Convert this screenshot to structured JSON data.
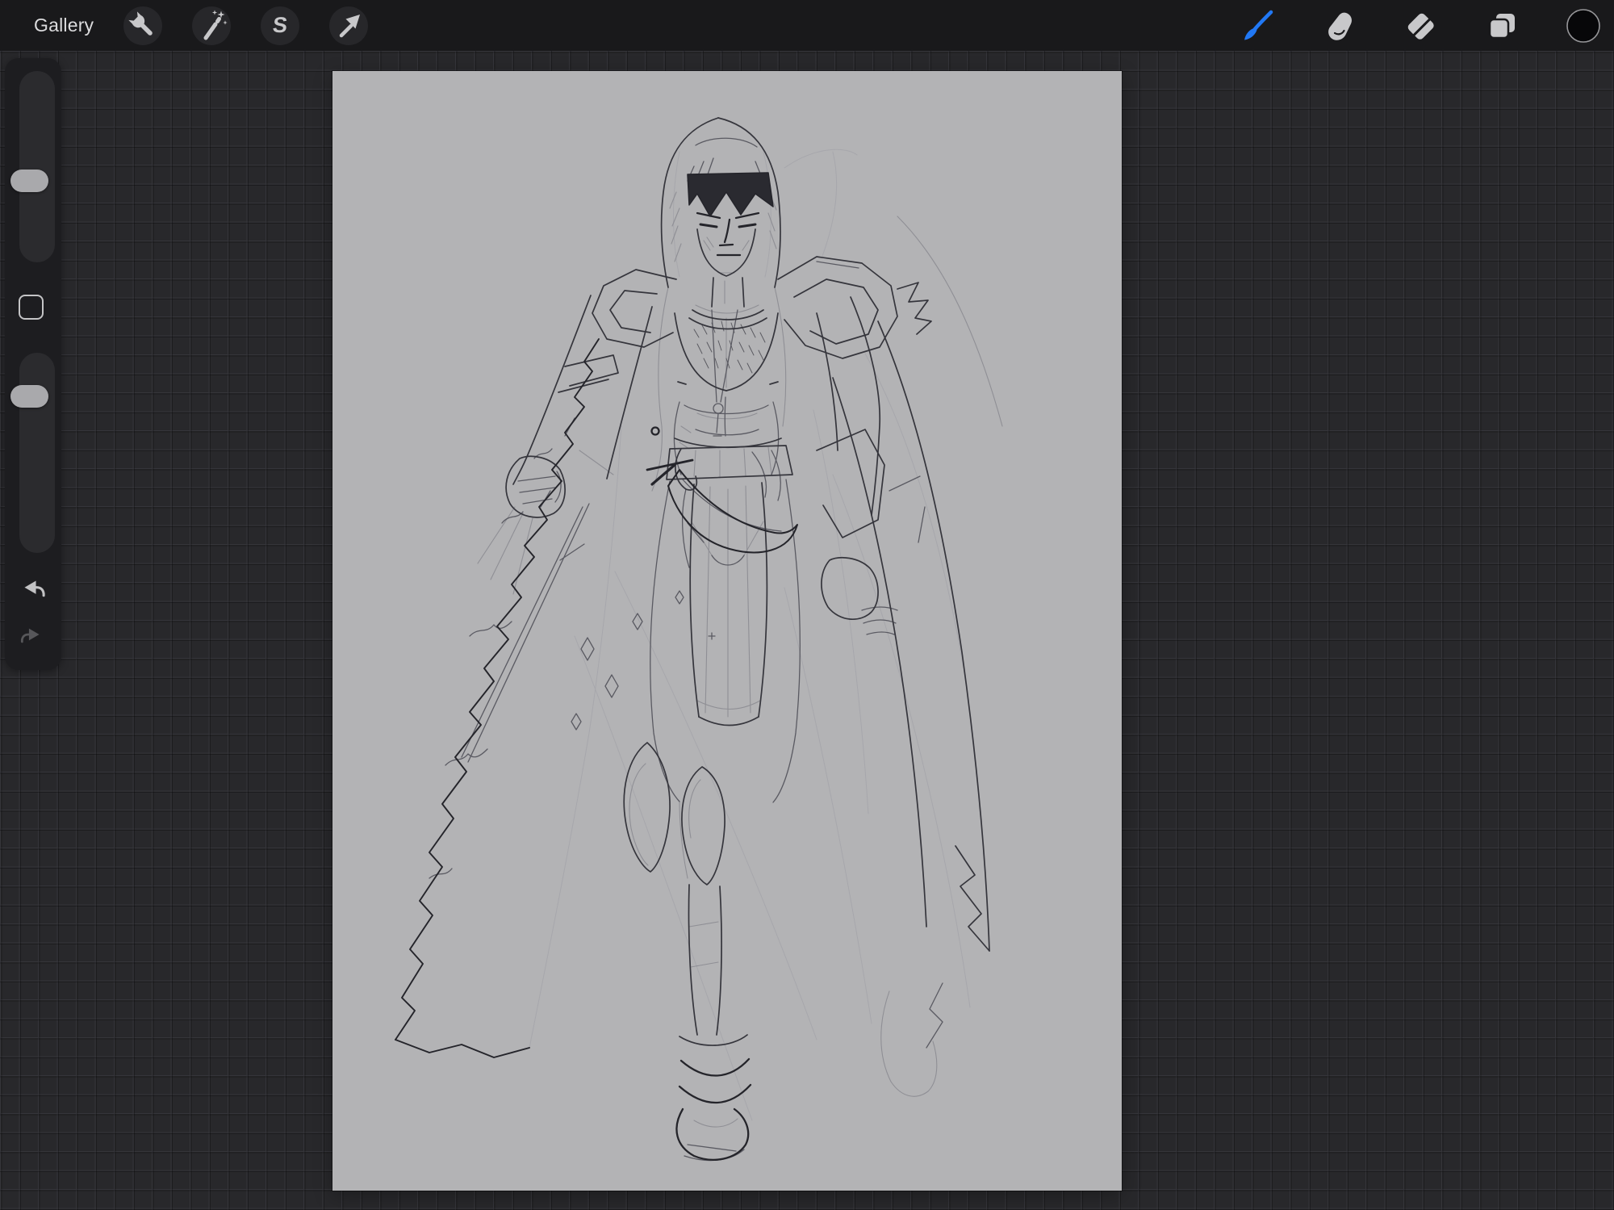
{
  "topbar": {
    "gallery_label": "Gallery",
    "left_tools": [
      {
        "id": "actions",
        "icon": "wrench-icon"
      },
      {
        "id": "adjustments",
        "icon": "magic-wand-icon"
      },
      {
        "id": "selection",
        "icon": "selection-s-icon",
        "glyph": "S"
      },
      {
        "id": "transform",
        "icon": "transform-arrow-icon"
      }
    ],
    "right_tools": [
      {
        "id": "paint",
        "icon": "paintbrush-icon",
        "active": true
      },
      {
        "id": "smudge",
        "icon": "smudge-finger-icon",
        "active": false
      },
      {
        "id": "erase",
        "icon": "eraser-icon",
        "active": false
      },
      {
        "id": "layers",
        "icon": "layers-icon",
        "active": false
      },
      {
        "id": "color",
        "icon": "color-swatch",
        "current_color": "#070709"
      }
    ]
  },
  "sidebar": {
    "brush_size_slider": {
      "id": "brush-size-slider"
    },
    "modify_button": {
      "id": "modify-button"
    },
    "opacity_slider": {
      "id": "opacity-slider"
    },
    "undo_button": {
      "icon": "undo-arrow-icon",
      "enabled": true
    },
    "redo_button": {
      "icon": "redo-arrow-icon",
      "enabled": false
    }
  },
  "canvas": {
    "description": "pencil sketch of a hooded warrior with cape, bare torso, belt dagger, armored knees and boots",
    "orientation": "portrait"
  },
  "colors": {
    "accent": "#2178f4",
    "topbar-bg": "#19191b",
    "grid-bg": "#28282b",
    "canvas-bg": "#b3b3b5"
  }
}
